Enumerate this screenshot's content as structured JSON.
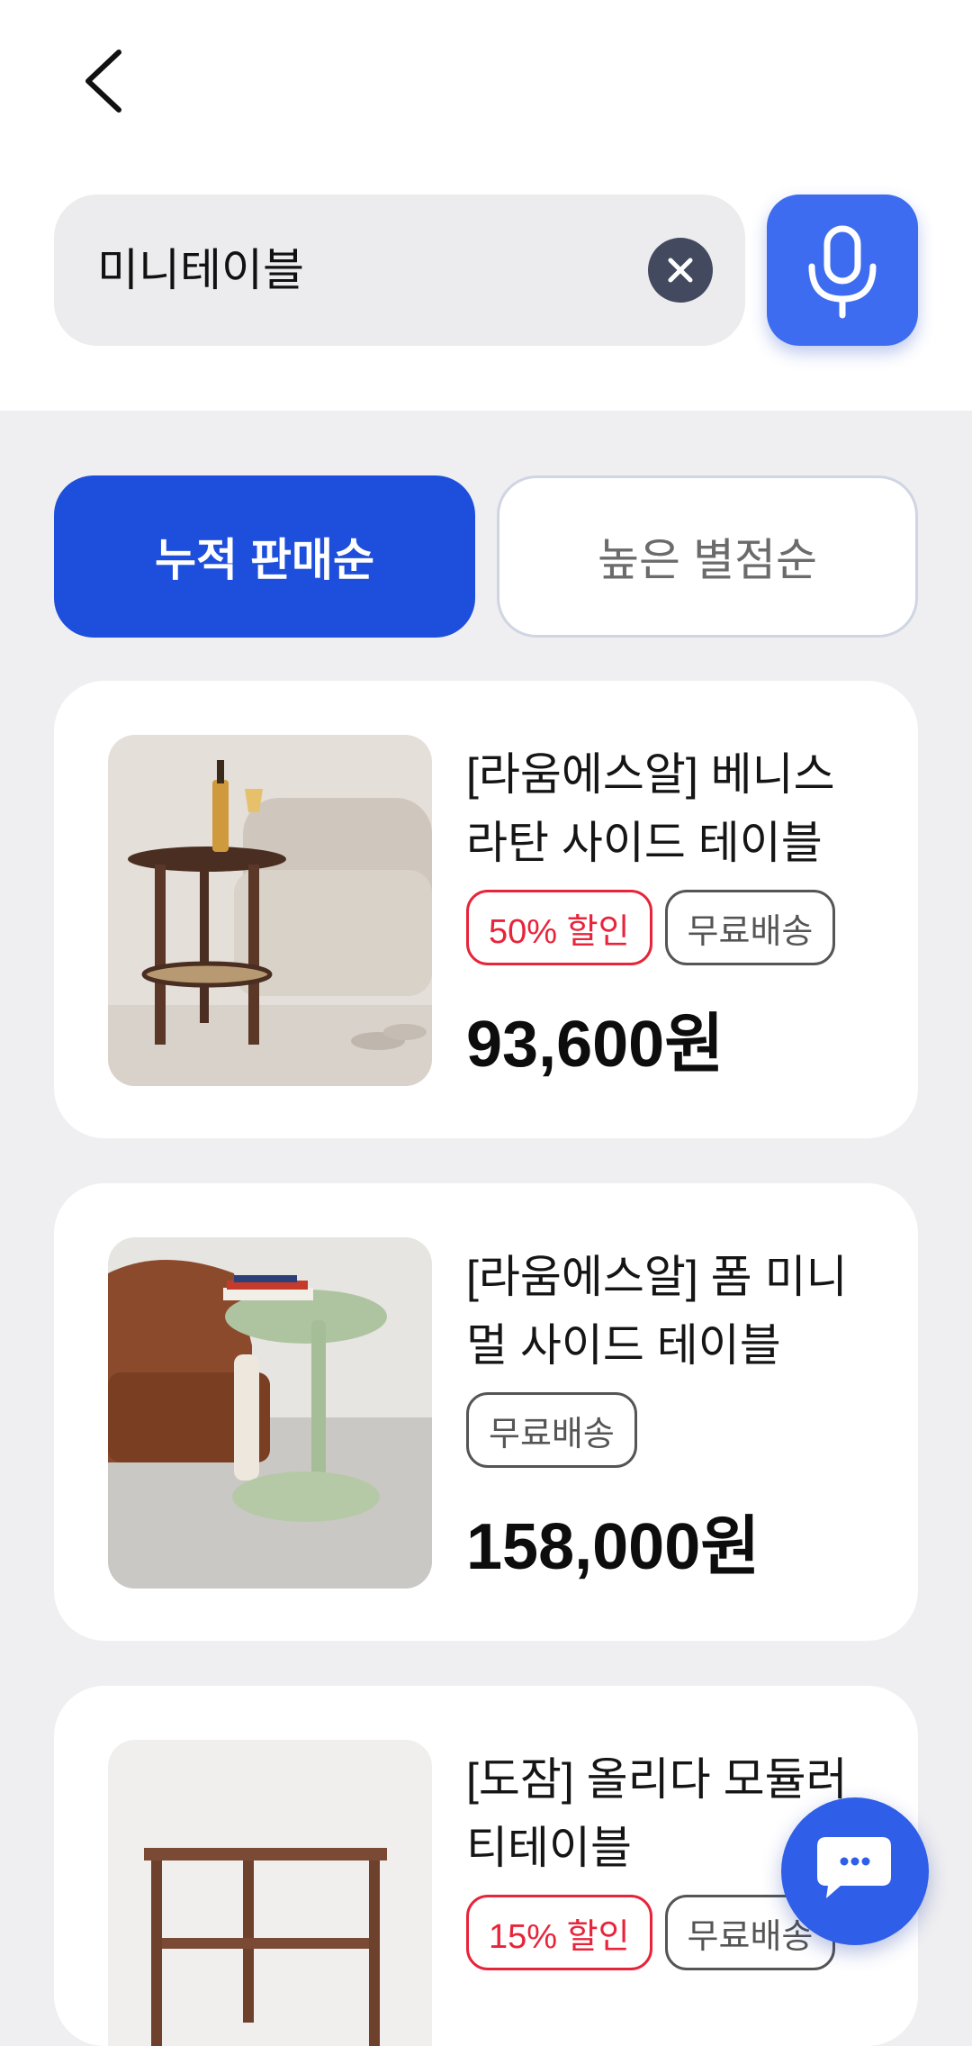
{
  "search": {
    "query": "미니테이블"
  },
  "sort": {
    "active_label": "누적 판매순",
    "inactive_label": "높은 별점순"
  },
  "products": [
    {
      "title_line1": "[라움에스알] 베니스",
      "title_line2": "라탄 사이드 테이블",
      "badges": [
        "50% 할인",
        "무료배송"
      ],
      "price": "93,600원",
      "image": "rattan-side-table-photo"
    },
    {
      "title_line1": "[라움에스알] 폼 미니",
      "title_line2": "멀 사이드 테이블",
      "badges": [
        "무료배송"
      ],
      "price": "158,000원",
      "image": "green-c-side-table-photo"
    },
    {
      "title_line1": "[도잠] 올리다 모듈러",
      "title_line2": "티테이블",
      "badges": [
        "15% 할인",
        "무료배송"
      ],
      "price": "",
      "image": "walnut-modular-table-photo"
    }
  ],
  "colors": {
    "primary": "#1e4fdc",
    "mic": "#3d6cf0",
    "discount_red": "#e8243a",
    "background": "#efeff1"
  },
  "icons": [
    "back-arrow-icon",
    "clear-icon",
    "microphone-icon",
    "chat-icon"
  ]
}
